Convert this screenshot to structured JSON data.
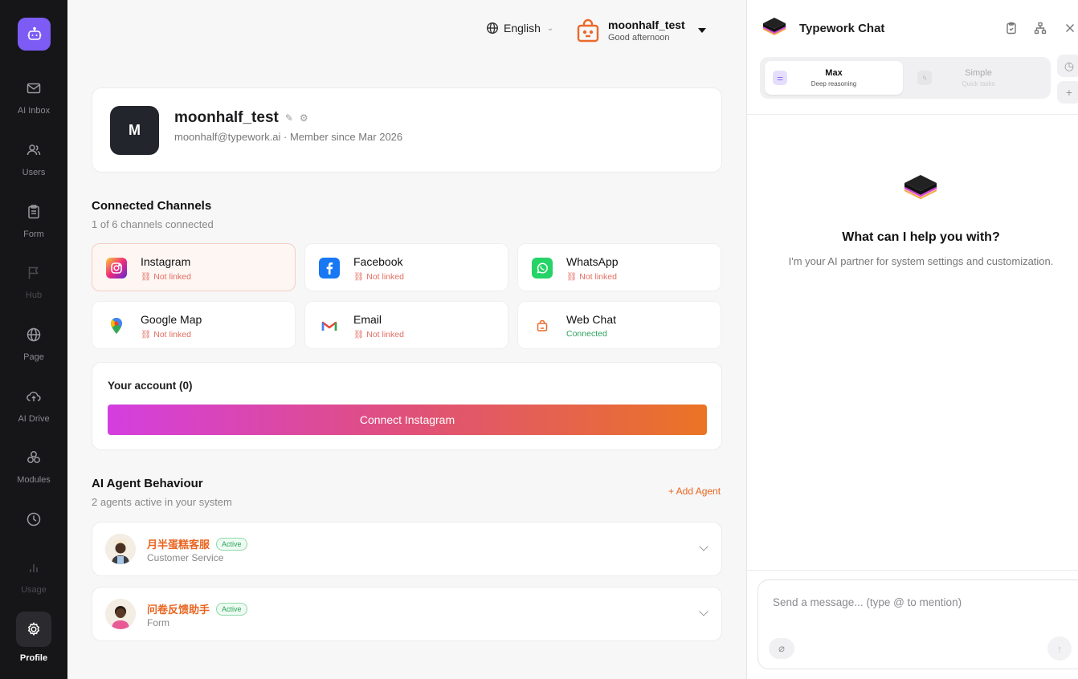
{
  "sidebar": {
    "items": [
      {
        "label": "AI Inbox",
        "icon": "mail-icon"
      },
      {
        "label": "Users",
        "icon": "users-icon"
      },
      {
        "label": "Form",
        "icon": "clipboard-icon"
      },
      {
        "label": "Hub",
        "icon": "flag-icon"
      },
      {
        "label": "Page",
        "icon": "globe-icon"
      },
      {
        "label": "AI Drive",
        "icon": "cloud-upload-icon"
      },
      {
        "label": "Modules",
        "icon": "modules-icon"
      },
      {
        "label": "",
        "icon": "clock-icon"
      },
      {
        "label": "Usage",
        "icon": "bar-chart-icon"
      },
      {
        "label": "Profile",
        "icon": "gear-icon"
      }
    ]
  },
  "topbar": {
    "language": "English",
    "username": "moonhalf_test",
    "greeting": "Good afternoon"
  },
  "profile": {
    "avatar_letter": "M",
    "name": "moonhalf_test",
    "email_line": "moonhalf@typework.ai · Member since Mar 2026"
  },
  "channels": {
    "title": "Connected Channels",
    "subtitle": "1 of 6 channels connected",
    "items": [
      {
        "name": "Instagram",
        "status": "Not linked"
      },
      {
        "name": "Facebook",
        "status": "Not linked"
      },
      {
        "name": "WhatsApp",
        "status": "Not linked"
      },
      {
        "name": "Google Map",
        "status": "Not linked"
      },
      {
        "name": "Email",
        "status": "Not linked"
      },
      {
        "name": "Web Chat",
        "status": "Connected"
      }
    ]
  },
  "account": {
    "title": "Your account (0)",
    "connect_label": "Connect Instagram"
  },
  "agents": {
    "title": "AI Agent Behaviour",
    "subtitle": "2 agents active in your system",
    "add_label": "+ Add Agent",
    "items": [
      {
        "name": "月半蛋糕客服",
        "badge": "Active",
        "role": "Customer Service"
      },
      {
        "name": "问卷反馈助手",
        "badge": "Active",
        "role": "Form"
      }
    ]
  },
  "chat": {
    "title": "Typework Chat",
    "modes": [
      {
        "name": "Max",
        "desc": "Deep reasoning"
      },
      {
        "name": "Simple",
        "desc": "Quick tasks"
      }
    ],
    "hero_title": "What can I help you with?",
    "hero_subtitle": "I'm your AI partner for system settings and customization.",
    "input_placeholder": "Send a message... (type @ to mention)"
  },
  "colors": {
    "accent": "#e8641f",
    "sidebar_bg": "#161618",
    "brand_purple": "#7c5cf5",
    "connected_green": "#2aa35a",
    "not_linked_red": "#e36d62"
  }
}
